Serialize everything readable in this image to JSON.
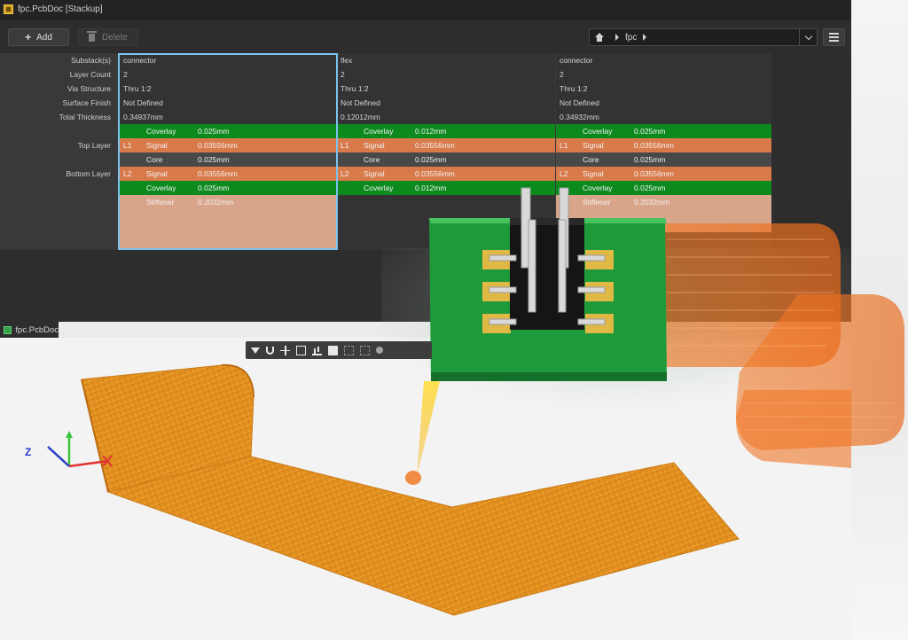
{
  "window": {
    "title": "fpc.PcbDoc [Stackup]"
  },
  "toolbar": {
    "add_label": "Add",
    "delete_label": "Delete"
  },
  "breadcrumb": {
    "root_icon": "home-icon",
    "item": "fpc"
  },
  "row_headers": [
    "Substack(s)",
    "Layer Count",
    "Via Structure",
    "Surface Finish",
    "Total Thickness",
    "Top Layer",
    "Bottom Layer"
  ],
  "substacks": [
    {
      "name": "connector",
      "layer_count": "2",
      "via_structure": "Thru 1:2",
      "surface_finish": "Not Defined",
      "total_thickness": "0.34937mm",
      "layers": [
        {
          "tag": "",
          "type": "Coverlay",
          "thickness": "0.025mm",
          "kind": "cov"
        },
        {
          "tag": "L1",
          "type": "Signal",
          "thickness": "0.03556mm",
          "kind": "sig"
        },
        {
          "tag": "",
          "type": "Core",
          "thickness": "0.025mm",
          "kind": "core"
        },
        {
          "tag": "L2",
          "type": "Signal",
          "thickness": "0.03556mm",
          "kind": "sig"
        },
        {
          "tag": "",
          "type": "Coverlay",
          "thickness": "0.025mm",
          "kind": "cov"
        },
        {
          "tag": "",
          "type": "Stiffener",
          "thickness": "0.2032mm",
          "kind": "stf"
        }
      ]
    },
    {
      "name": "flex",
      "layer_count": "2",
      "via_structure": "Thru 1:2",
      "surface_finish": "Not Defined",
      "total_thickness": "0.12012mm",
      "layers": [
        {
          "tag": "",
          "type": "Coverlay",
          "thickness": "0.012mm",
          "kind": "cov"
        },
        {
          "tag": "L1",
          "type": "Signal",
          "thickness": "0.03556mm",
          "kind": "sig"
        },
        {
          "tag": "",
          "type": "Core",
          "thickness": "0.025mm",
          "kind": "core"
        },
        {
          "tag": "L2",
          "type": "Signal",
          "thickness": "0.03556mm",
          "kind": "sig"
        },
        {
          "tag": "",
          "type": "Coverlay",
          "thickness": "0.012mm",
          "kind": "cov"
        }
      ]
    },
    {
      "name": "connector",
      "layer_count": "2",
      "via_structure": "Thru 1:2",
      "surface_finish": "Not Defined",
      "total_thickness": "0.34932mm",
      "layers": [
        {
          "tag": "",
          "type": "Coverlay",
          "thickness": "0.025mm",
          "kind": "cov"
        },
        {
          "tag": "L1",
          "type": "Signal",
          "thickness": "0.03556mm",
          "kind": "sig"
        },
        {
          "tag": "",
          "type": "Core",
          "thickness": "0.025mm",
          "kind": "core"
        },
        {
          "tag": "L2",
          "type": "Signal",
          "thickness": "0.03556mm",
          "kind": "sig"
        },
        {
          "tag": "",
          "type": "Coverlay",
          "thickness": "0.025mm",
          "kind": "cov"
        },
        {
          "tag": "",
          "type": "Stiffener",
          "thickness": "0.2032mm",
          "kind": "stf"
        }
      ]
    }
  ],
  "document_tab": {
    "label": "fpc.PcbDoc"
  },
  "view_toolbar": {
    "icons": [
      "filter-icon",
      "snap-magnet-icon",
      "crosshair-icon",
      "select-box-icon",
      "layer-stack-icon",
      "fill-icon",
      "dimension-icon",
      "text-icon",
      "pin-icon"
    ]
  },
  "axes": {
    "z_label": "Z"
  },
  "colors": {
    "coverlay": "#0d8a1e",
    "signal": "#d97a4b",
    "core": "#484848",
    "stiffener": "#d9a58a",
    "selection": "#7cc2ef",
    "flex_copper": "#e8951c",
    "pcb_green": "#1f9a3a"
  }
}
